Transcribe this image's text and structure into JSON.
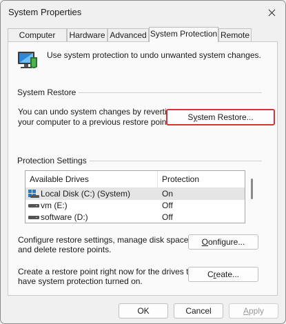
{
  "window": {
    "title": "System Properties"
  },
  "tabs": [
    {
      "label": "Computer Name",
      "active": false
    },
    {
      "label": "Hardware",
      "active": false
    },
    {
      "label": "Advanced",
      "active": false
    },
    {
      "label": "System Protection",
      "active": true
    },
    {
      "label": "Remote",
      "active": false
    }
  ],
  "intro": {
    "text": "Use system protection to undo unwanted system changes."
  },
  "system_restore": {
    "section_title": "System Restore",
    "description_line1": "You can undo system changes by reverting",
    "description_line2": "your computer to a previous restore point.",
    "button_prefix": "S",
    "button_underlined": "y",
    "button_suffix": "stem Restore...",
    "highlight_color": "#d9322f"
  },
  "protection": {
    "section_title": "Protection Settings",
    "columns": [
      "Available Drives",
      "Protection"
    ],
    "drives": [
      {
        "name": "Local Disk (C:) (System)",
        "protection": "On",
        "icon": "system-drive-icon",
        "selected": true
      },
      {
        "name": "vm (E:)",
        "protection": "Off",
        "icon": "drive-icon",
        "selected": false
      },
      {
        "name": "software (D:)",
        "protection": "Off",
        "icon": "drive-icon",
        "selected": false
      }
    ],
    "configure_line1": "Configure restore settings, manage disk space,",
    "configure_line2": "and delete restore points.",
    "configure_button_underlined": "O",
    "configure_button_suffix": "onfigure...",
    "create_line1": "Create a restore point right now for the drives that",
    "create_line2": "have system protection turned on.",
    "create_button_prefix": "C",
    "create_button_underlined": "r",
    "create_button_suffix": "eate..."
  },
  "footer": {
    "ok_label": "OK",
    "cancel_label": "Cancel",
    "apply_prefix": "",
    "apply_underlined": "A",
    "apply_suffix": "pply"
  }
}
